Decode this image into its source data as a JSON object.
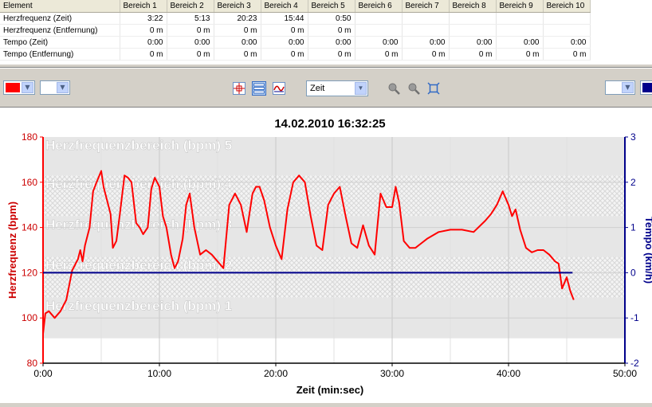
{
  "table": {
    "headers": [
      "Element",
      "Bereich 1",
      "Bereich 2",
      "Bereich 3",
      "Bereich 4",
      "Bereich 5",
      "Bereich 6",
      "Bereich 7",
      "Bereich 8",
      "Bereich 9",
      "Bereich 10"
    ],
    "rows": [
      {
        "label": "Herzfrequenz (Zeit)",
        "cells": [
          "3:22",
          "5:13",
          "20:23",
          "15:44",
          "0:50",
          "",
          "",
          "",
          "",
          ""
        ]
      },
      {
        "label": "Herzfrequenz (Entfernung)",
        "cells": [
          "0 m",
          "0 m",
          "0 m",
          "0 m",
          "0 m",
          "",
          "",
          "",
          "",
          ""
        ]
      },
      {
        "label": "Tempo (Zeit)",
        "cells": [
          "0:00",
          "0:00",
          "0:00",
          "0:00",
          "0:00",
          "0:00",
          "0:00",
          "0:00",
          "0:00",
          "0:00"
        ]
      },
      {
        "label": "Tempo (Entfernung)",
        "cells": [
          "0 m",
          "0 m",
          "0 m",
          "0 m",
          "0 m",
          "0 m",
          "0 m",
          "0 m",
          "0 m",
          "0 m"
        ]
      }
    ]
  },
  "toolbar": {
    "left_color": "#ff0000",
    "left_color2": "#ffffff",
    "right_color": "#ffffff",
    "right_color2": "#00008b",
    "axis_select": "Zeit",
    "icons": [
      "crosshair-icon",
      "horizontal-bands-icon",
      "wave-icon",
      "zoom-in-icon",
      "zoom-out-icon",
      "zoom-fit-icon"
    ]
  },
  "chart_data": {
    "type": "line",
    "title": "14.02.2010 16:32:25",
    "xlabel": "Zeit (min:sec)",
    "ylabel_left": "Herzfrequenz (bpm)",
    "ylabel_right": "Tempo (km/h)",
    "xlim": [
      0,
      50
    ],
    "ylim_left": [
      80,
      180
    ],
    "ylim_right": [
      -2,
      3
    ],
    "x_ticks": [
      "0:00",
      "10:00",
      "20:00",
      "30:00",
      "40:00",
      "50:00"
    ],
    "y_left_ticks": [
      "80",
      "100",
      "120",
      "140",
      "160",
      "180"
    ],
    "y_right_ticks": [
      "-2",
      "-1",
      "0",
      "1",
      "2",
      "3"
    ],
    "grid": true,
    "zones": [
      {
        "name": "Herzfrequenzbereich (bpm) 1",
        "from": 91,
        "to": 109,
        "style": "solid"
      },
      {
        "name": "Herzfrequenzbereich (bpm) 2",
        "from": 109,
        "to": 127,
        "style": "hatch"
      },
      {
        "name": "Herzfrequenzbereich (bpm) 3",
        "from": 127,
        "to": 145,
        "style": "solid"
      },
      {
        "name": "Herzfrequenzbereich (bpm) 4",
        "from": 145,
        "to": 163,
        "style": "hatch"
      },
      {
        "name": "Herzfrequenzbereich (bpm) 5",
        "from": 163,
        "to": 180,
        "style": "solid"
      }
    ],
    "series": [
      {
        "axis": "left",
        "color": "#ff0000",
        "x": [
          0.0,
          0.2,
          0.5,
          1.0,
          1.5,
          2.0,
          2.5,
          3.0,
          3.2,
          3.4,
          3.6,
          4.0,
          4.3,
          4.6,
          5.0,
          5.2,
          5.5,
          5.8,
          6.0,
          6.3,
          6.6,
          7.0,
          7.3,
          7.6,
          8.0,
          8.3,
          8.6,
          9.0,
          9.3,
          9.6,
          10.0,
          10.3,
          10.6,
          11.0,
          11.3,
          11.6,
          12.0,
          12.3,
          12.6,
          13.0,
          13.5,
          14.0,
          14.5,
          15.0,
          15.5,
          16.0,
          16.5,
          17.0,
          17.5,
          18.0,
          18.3,
          18.6,
          19.0,
          19.5,
          20.0,
          20.5,
          21.0,
          21.5,
          22.0,
          22.5,
          23.0,
          23.5,
          24.0,
          24.5,
          25.0,
          25.5,
          26.0,
          26.5,
          27.0,
          27.5,
          28.0,
          28.5,
          29.0,
          29.5,
          30.0,
          30.3,
          30.6,
          31.0,
          31.5,
          32.0,
          32.5,
          33.0,
          34.0,
          35.0,
          36.0,
          37.0,
          38.0,
          38.5,
          39.0,
          39.5,
          40.0,
          40.3,
          40.6,
          41.0,
          41.5,
          42.0,
          42.5,
          43.0,
          43.5,
          44.0,
          44.3,
          44.6,
          45.0,
          45.3,
          45.6
        ],
        "y": [
          93,
          102,
          103,
          100,
          103,
          108,
          121,
          126,
          130,
          125,
          132,
          140,
          156,
          160,
          165,
          158,
          152,
          146,
          131,
          134,
          146,
          163,
          162,
          160,
          142,
          140,
          137,
          140,
          157,
          162,
          158,
          145,
          140,
          128,
          122,
          125,
          135,
          150,
          155,
          140,
          128,
          130,
          128,
          125,
          122,
          150,
          155,
          150,
          138,
          155,
          158,
          158,
          152,
          140,
          132,
          126,
          148,
          160,
          163,
          160,
          145,
          132,
          130,
          150,
          155,
          158,
          145,
          133,
          131,
          141,
          132,
          128,
          155,
          149,
          149,
          158,
          151,
          134,
          131,
          131,
          133,
          135,
          138,
          139,
          139,
          138,
          143,
          146,
          150,
          156,
          150,
          145,
          148,
          139,
          131,
          129,
          130,
          130,
          128,
          125,
          124,
          113,
          118,
          112,
          108
        ]
      },
      {
        "axis": "right",
        "color": "#00008b",
        "x": [
          0,
          45.5
        ],
        "y": [
          0,
          0
        ]
      }
    ]
  }
}
